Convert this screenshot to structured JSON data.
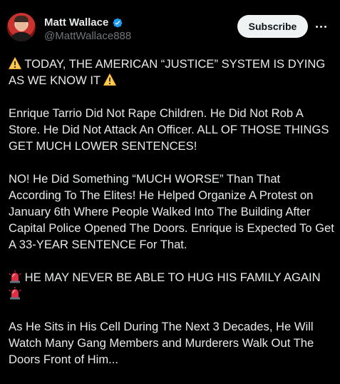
{
  "author": {
    "display_name": "Matt Wallace",
    "handle": "@MattWallace888"
  },
  "actions": {
    "subscribe_label": "Subscribe",
    "more_icon": "more-horizontal-icon"
  },
  "colors": {
    "background": "#000000",
    "text": "#e7e9ea",
    "muted": "#71767b",
    "verified": "#1d9bf0",
    "button_bg": "#eff3f4"
  },
  "tweet": {
    "line1": "TODAY, THE AMERICAN “JUSTICE” SYSTEM IS DYING AS WE KNOW IT",
    "para2": "Enrique Tarrio Did Not Rape Children. He Did Not Rob A Store. He Did Not Attack An Officer. ALL OF THOSE THINGS GET MUCH LOWER SENTENCES!",
    "para3": "NO! He Did Something “MUCH WORSE” Than That According To The Elites! He Helped Organize A Protest on January 6th Where People Walked Into The Building After Capital Police Opened The Doors. Enrique is Expected To Get A 33-YEAR SENTENCE For That.",
    "line4": "HE MAY NEVER BE ABLE TO HUG HIS FAMILY AGAIN",
    "para5": "As He Sits in His Cell During The Next 3 Decades, He Will Watch Many Gang Members and Murderers Walk Out The Doors Front of Him..."
  },
  "icons": {
    "warning": "warning-icon",
    "siren": "siren-icon",
    "verified": "verified-badge-icon"
  }
}
